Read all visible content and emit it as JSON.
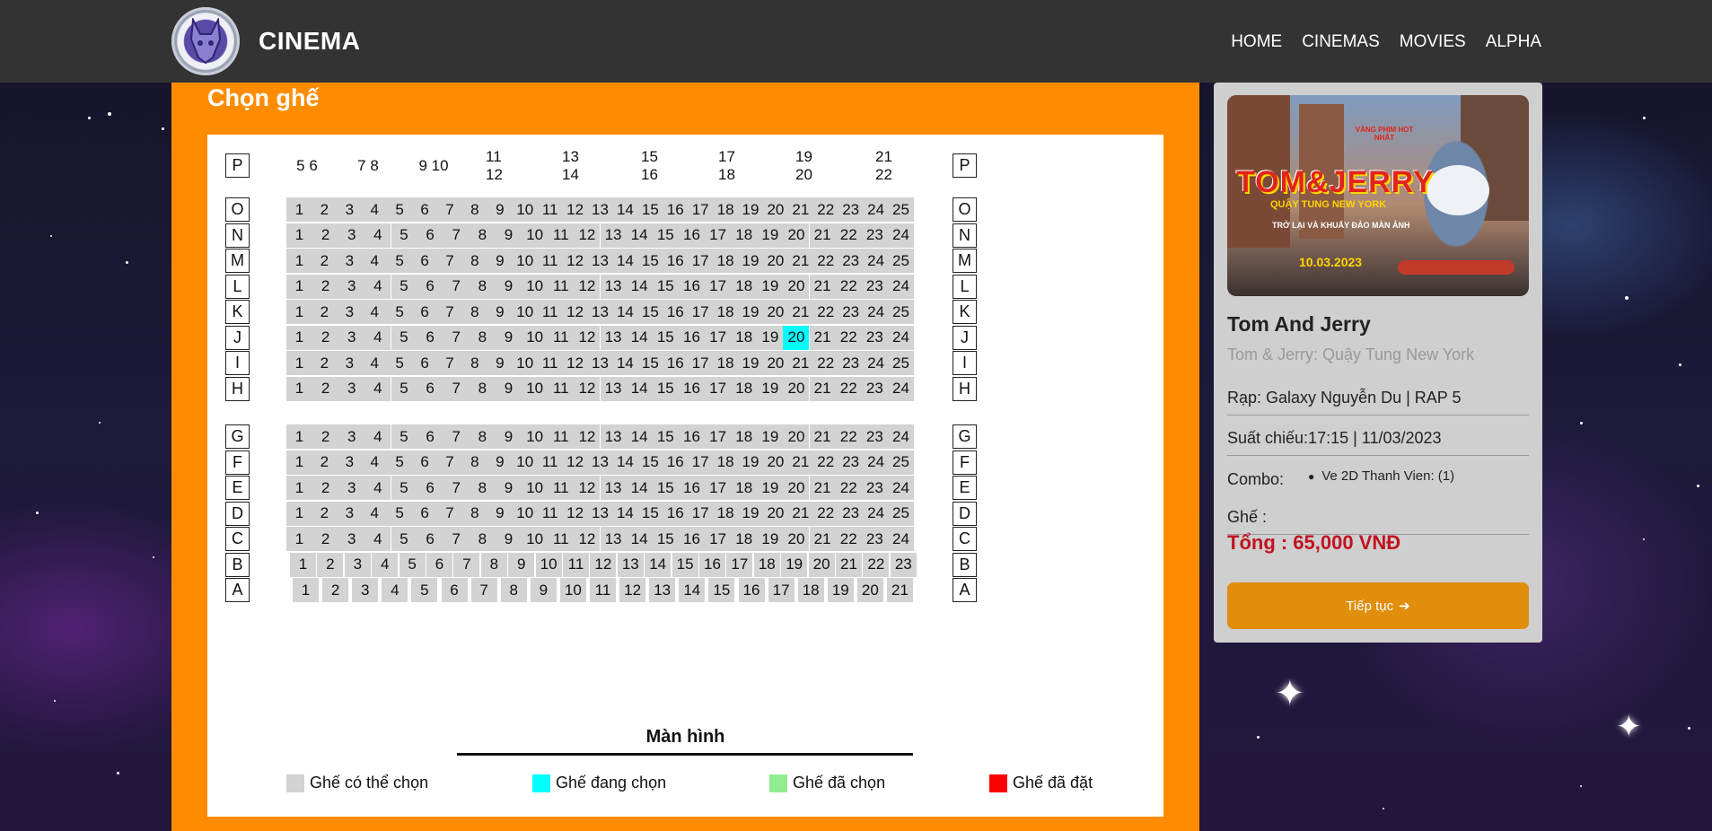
{
  "navbar": {
    "brand": "CINEMA",
    "links": [
      "HOME",
      "CINEMAS",
      "MOVIES",
      "ALPHA"
    ]
  },
  "page_title": "Chọn ghế",
  "seat_map": {
    "vip_row": {
      "label": "P",
      "pairs": [
        "5 6",
        "7 8",
        "9 10",
        "11 12",
        "13 14",
        "15 16",
        "17 18",
        "19 20",
        "21 22"
      ]
    },
    "rows": [
      {
        "label": "O",
        "count": 25
      },
      {
        "label": "N",
        "count": 24
      },
      {
        "label": "M",
        "count": 25
      },
      {
        "label": "L",
        "count": 24
      },
      {
        "label": "K",
        "count": 25
      },
      {
        "label": "J",
        "count": 24,
        "selecting": [
          20
        ]
      },
      {
        "label": "I",
        "count": 25
      },
      {
        "label": "H",
        "count": 24
      },
      {
        "label": "G",
        "count": 24
      },
      {
        "label": "F",
        "count": 25
      },
      {
        "label": "E",
        "count": 24
      },
      {
        "label": "D",
        "count": 25
      },
      {
        "label": "C",
        "count": 24
      },
      {
        "label": "B",
        "count": 23
      },
      {
        "label": "A",
        "count": 21
      }
    ],
    "screen_label": "Màn hình"
  },
  "legend": [
    {
      "label": "Ghế có thể chọn",
      "color": "#d3d3d3"
    },
    {
      "label": "Ghế đang chọn",
      "color": "#00ffff"
    },
    {
      "label": "Ghế đã chọn",
      "color": "#90ee90"
    },
    {
      "label": "Ghế đã đặt",
      "color": "#ff0000"
    }
  ],
  "booking": {
    "poster": {
      "title": "TOM&JERRY",
      "subtitle": "QUẬY TUNG NEW YORK",
      "tagline": "TRỞ LẠI VÀ KHUẤY ĐẢO MÀN ẢNH",
      "release_date": "10.03.2023",
      "top_text": "VÀNG PHIM HOT NHẤT"
    },
    "movie_title": "Tom And Jerry",
    "movie_subtitle": "Tom & Jerry: Quậy Tung New York",
    "cinema": "Rạp: Galaxy Nguyễn Du | RAP 5",
    "showtime": "Suất chiếu:17:15 | 11/03/2023",
    "combo_label": "Combo:",
    "combo_items": [
      "Ve 2D Thanh Vien: (1)"
    ],
    "seats_label": "Ghế :",
    "total": "Tổng : 65,000 VNĐ",
    "continue_label": "Tiếp tục",
    "continue_icon": "arrow-right-icon"
  },
  "colors": {
    "navbar": "#333333",
    "panel": "#ff8c00",
    "seat_available": "#d3d3d3",
    "seat_selecting": "#00ffff",
    "total": "#c1121f",
    "button": "#e08e0b"
  }
}
